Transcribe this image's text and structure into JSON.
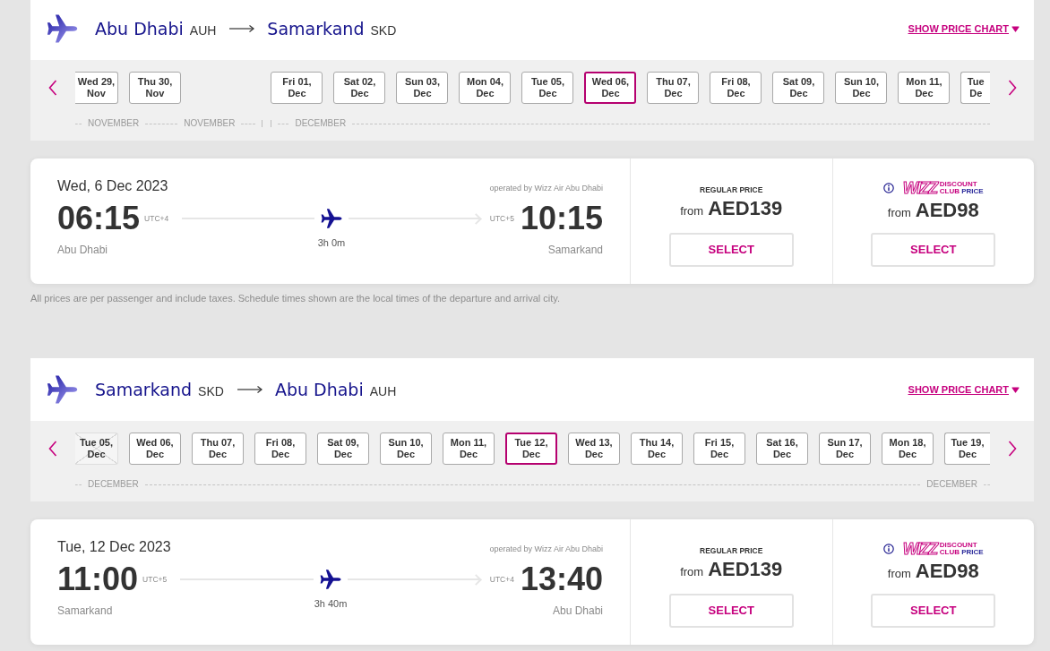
{
  "journeys": [
    {
      "route": {
        "origin": {
          "city": "Abu Dhabi",
          "code": "AUH"
        },
        "destination": {
          "city": "Samarkand",
          "code": "SKD"
        }
      },
      "price_chart_link": "SHOW PRICE CHART",
      "months": [
        {
          "labels": [
            "NOVEMBER",
            "NOVEMBER"
          ],
          "dates": [
            {
              "day": "Wed 29,",
              "month": "Nov",
              "selected": false,
              "disabled": false
            },
            {
              "day": "Thu 30,",
              "month": "Nov",
              "selected": false,
              "disabled": false
            }
          ]
        },
        {
          "labels": [
            "DECEMBER"
          ],
          "dates": [
            {
              "day": "Fri 01,",
              "month": "Dec",
              "selected": false,
              "disabled": false
            },
            {
              "day": "Sat 02,",
              "month": "Dec",
              "selected": false,
              "disabled": false
            },
            {
              "day": "Sun 03,",
              "month": "Dec",
              "selected": false,
              "disabled": false
            },
            {
              "day": "Mon 04,",
              "month": "Dec",
              "selected": false,
              "disabled": false
            },
            {
              "day": "Tue 05,",
              "month": "Dec",
              "selected": false,
              "disabled": false
            },
            {
              "day": "Wed 06,",
              "month": "Dec",
              "selected": true,
              "disabled": false
            },
            {
              "day": "Thu 07,",
              "month": "Dec",
              "selected": false,
              "disabled": false
            },
            {
              "day": "Fri 08,",
              "month": "Dec",
              "selected": false,
              "disabled": false
            },
            {
              "day": "Sat 09,",
              "month": "Dec",
              "selected": false,
              "disabled": false
            },
            {
              "day": "Sun 10,",
              "month": "Dec",
              "selected": false,
              "disabled": false
            },
            {
              "day": "Mon 11,",
              "month": "Dec",
              "selected": false,
              "disabled": false
            },
            {
              "day": "Tue",
              "month": "De",
              "selected": false,
              "disabled": false
            }
          ]
        }
      ],
      "flight": {
        "date": "Wed, 6 Dec 2023",
        "operator": "operated by Wizz Air Abu Dhabi",
        "departure": {
          "time": "06:15",
          "timezone": "UTC+4",
          "city": "Abu Dhabi"
        },
        "duration": "3h 0m",
        "arrival": {
          "time": "10:15",
          "timezone": "UTC+5",
          "city": "Samarkand"
        }
      },
      "fares": [
        {
          "kind": "regular",
          "title": "REGULAR PRICE",
          "prefix": "from",
          "price": "AED139",
          "button": "SELECT"
        },
        {
          "kind": "club",
          "brand": "WIZZ",
          "label": [
            "DISCOUNT",
            "CLUB",
            "PRICE"
          ],
          "prefix": "from",
          "price": "AED98",
          "button": "SELECT"
        }
      ],
      "note": "All prices are per passenger and include taxes. Schedule times shown are the local times of the departure and arrival city."
    },
    {
      "route": {
        "origin": {
          "city": "Samarkand",
          "code": "SKD"
        },
        "destination": {
          "city": "Abu Dhabi",
          "code": "AUH"
        }
      },
      "price_chart_link": "SHOW PRICE CHART",
      "months": [
        {
          "labels": [
            "DECEMBER",
            "DECEMBER"
          ],
          "dates": [
            {
              "day": "Tue 05,",
              "month": "Dec",
              "selected": false,
              "disabled": true
            },
            {
              "day": "Wed 06,",
              "month": "Dec",
              "selected": false,
              "disabled": false
            },
            {
              "day": "Thu 07,",
              "month": "Dec",
              "selected": false,
              "disabled": false
            },
            {
              "day": "Fri 08,",
              "month": "Dec",
              "selected": false,
              "disabled": false
            },
            {
              "day": "Sat 09,",
              "month": "Dec",
              "selected": false,
              "disabled": false
            },
            {
              "day": "Sun 10,",
              "month": "Dec",
              "selected": false,
              "disabled": false
            },
            {
              "day": "Mon 11,",
              "month": "Dec",
              "selected": false,
              "disabled": false
            },
            {
              "day": "Tue 12,",
              "month": "Dec",
              "selected": true,
              "disabled": false
            },
            {
              "day": "Wed 13,",
              "month": "Dec",
              "selected": false,
              "disabled": false
            },
            {
              "day": "Thu 14,",
              "month": "Dec",
              "selected": false,
              "disabled": false
            },
            {
              "day": "Fri 15,",
              "month": "Dec",
              "selected": false,
              "disabled": false
            },
            {
              "day": "Sat 16,",
              "month": "Dec",
              "selected": false,
              "disabled": false
            },
            {
              "day": "Sun 17,",
              "month": "Dec",
              "selected": false,
              "disabled": false
            },
            {
              "day": "Mon 18,",
              "month": "Dec",
              "selected": false,
              "disabled": false
            },
            {
              "day": "Tue 19,",
              "month": "Dec",
              "selected": false,
              "disabled": false
            }
          ]
        }
      ],
      "flight": {
        "date": "Tue, 12 Dec 2023",
        "operator": "operated by Wizz Air Abu Dhabi",
        "departure": {
          "time": "11:00",
          "timezone": "UTC+5",
          "city": "Samarkand"
        },
        "duration": "3h 40m",
        "arrival": {
          "time": "13:40",
          "timezone": "UTC+4",
          "city": "Abu Dhabi"
        }
      },
      "fares": [
        {
          "kind": "regular",
          "title": "REGULAR PRICE",
          "prefix": "from",
          "price": "AED139",
          "button": "SELECT"
        },
        {
          "kind": "club",
          "brand": "WIZZ",
          "label": [
            "DISCOUNT",
            "CLUB",
            "PRICE"
          ],
          "prefix": "from",
          "price": "AED98",
          "button": "SELECT"
        }
      ]
    }
  ]
}
